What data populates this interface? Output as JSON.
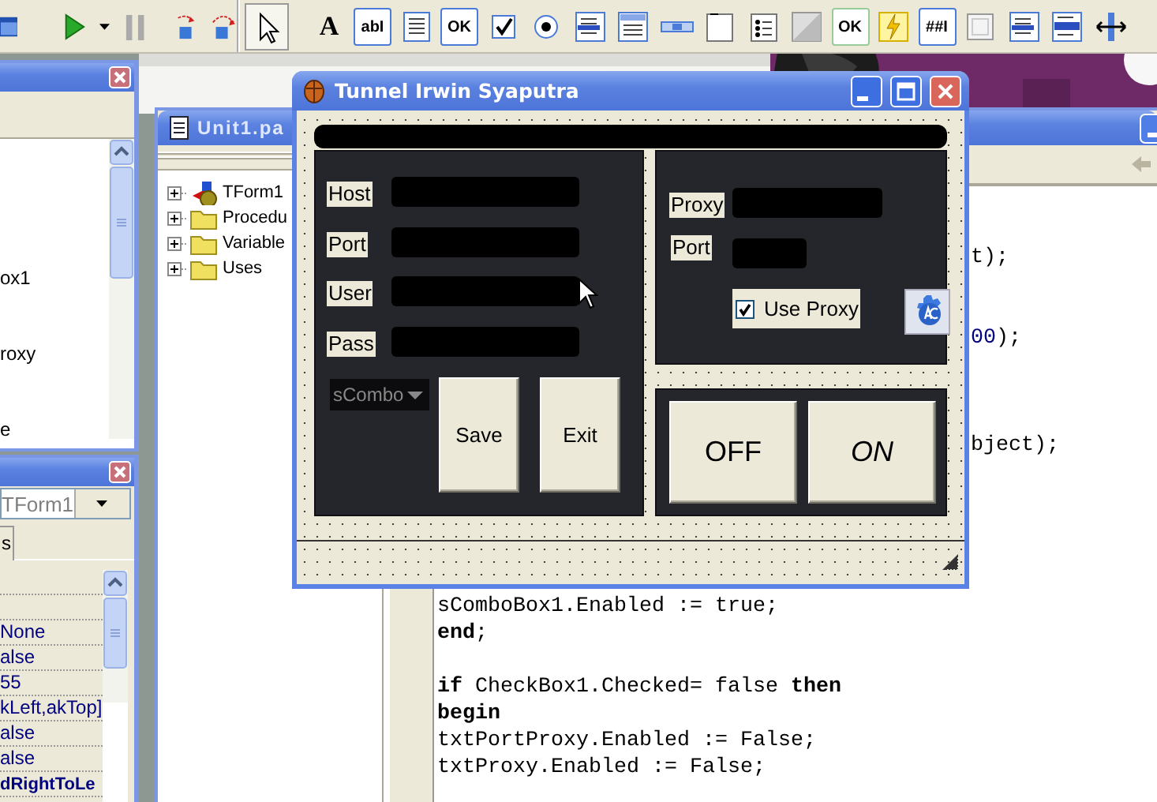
{
  "toolbar": {
    "tools": [
      {
        "kind": "pointer"
      },
      {
        "kind": "label",
        "label": "A"
      },
      {
        "kind": "edit",
        "label": "abI"
      },
      {
        "kind": "memo"
      },
      {
        "kind": "button",
        "label": "OK"
      },
      {
        "kind": "checkbox"
      },
      {
        "kind": "radio"
      },
      {
        "kind": "listbox"
      },
      {
        "kind": "combobox"
      },
      {
        "kind": "scrollbar"
      },
      {
        "kind": "groupbox"
      },
      {
        "kind": "radiogroup"
      },
      {
        "kind": "panel"
      },
      {
        "kind": "bitbtn",
        "label": "OK"
      },
      {
        "kind": "action"
      },
      {
        "kind": "maskedit",
        "label": "##I"
      },
      {
        "kind": "bevel"
      },
      {
        "kind": "listbox"
      },
      {
        "kind": "checklist"
      },
      {
        "kind": "splitter"
      }
    ]
  },
  "tree_panel": {
    "items": [
      "ox1",
      "roxy",
      "e"
    ]
  },
  "inspector": {
    "object": "TForm1",
    "tab": "s",
    "rows": [
      {
        "value": "None",
        "bold": false
      },
      {
        "value": "alse",
        "bold": false
      },
      {
        "value": "55",
        "bold": false
      },
      {
        "value": "kLeft,akTop]",
        "bold": false
      },
      {
        "value": "alse",
        "bold": false
      },
      {
        "value": "alse",
        "bold": false
      },
      {
        "value": "dRightToLe",
        "bold": true
      }
    ]
  },
  "editor": {
    "title": "Unit1.pa",
    "explorer": [
      {
        "label": "TForm1",
        "kind": "class"
      },
      {
        "label": "Procedu",
        "kind": "folder"
      },
      {
        "label": "Variable",
        "kind": "folder"
      },
      {
        "label": "Uses",
        "kind": "folder"
      }
    ],
    "code": [
      {
        "kind": "blank"
      },
      {
        "kind": "blank"
      },
      {
        "kind": "tail",
        "segments": [
          {
            "text": "t);",
            "kind": "plain"
          }
        ]
      },
      {
        "kind": "blank"
      },
      {
        "kind": "blank"
      },
      {
        "kind": "tail",
        "segments": [
          {
            "text": "00",
            "kind": "number"
          },
          {
            "text": ");",
            "kind": "plain"
          }
        ]
      },
      {
        "kind": "blank"
      },
      {
        "kind": "blank"
      },
      {
        "kind": "blank"
      },
      {
        "kind": "tail",
        "segments": [
          {
            "text": "bject);",
            "kind": "plain"
          }
        ]
      },
      {
        "kind": "blank"
      },
      {
        "kind": "blank"
      },
      {
        "kind": "blank"
      },
      {
        "kind": "blank"
      },
      {
        "kind": "blank"
      },
      {
        "kind": "code",
        "segments": [
          {
            "text": "sComboBox1.Enabled := true;",
            "kind": "plain"
          }
        ]
      },
      {
        "kind": "code",
        "segments": [
          {
            "text": "end",
            "kind": "keyword"
          },
          {
            "text": ";",
            "kind": "plain"
          }
        ]
      },
      {
        "kind": "blank"
      },
      {
        "kind": "code",
        "segments": [
          {
            "text": "if",
            "kind": "keyword"
          },
          {
            "text": " CheckBox1.Checked= false ",
            "kind": "plain"
          },
          {
            "text": "then",
            "kind": "keyword"
          }
        ]
      },
      {
        "kind": "code",
        "segments": [
          {
            "text": "begin",
            "kind": "keyword"
          }
        ]
      },
      {
        "kind": "code",
        "segments": [
          {
            "text": "txtPortProxy.Enabled := False;",
            "kind": "plain"
          }
        ]
      },
      {
        "kind": "code",
        "segments": [
          {
            "text": "txtProxy.Enabled := False;",
            "kind": "plain"
          }
        ]
      }
    ]
  },
  "form": {
    "title": "Tunnel Irwin Syaputra",
    "login_panel": {
      "fields": [
        "Host",
        "Port",
        "User",
        "Pass"
      ],
      "combo": {
        "value": "sCombo"
      },
      "buttons": [
        "Save",
        "Exit"
      ]
    },
    "proxy_panel": {
      "proxy_label": "Proxy",
      "port_label": "Port",
      "use_proxy": {
        "label": "Use Proxy",
        "checked": true
      }
    },
    "power_buttons": [
      "OFF",
      "ON"
    ]
  }
}
